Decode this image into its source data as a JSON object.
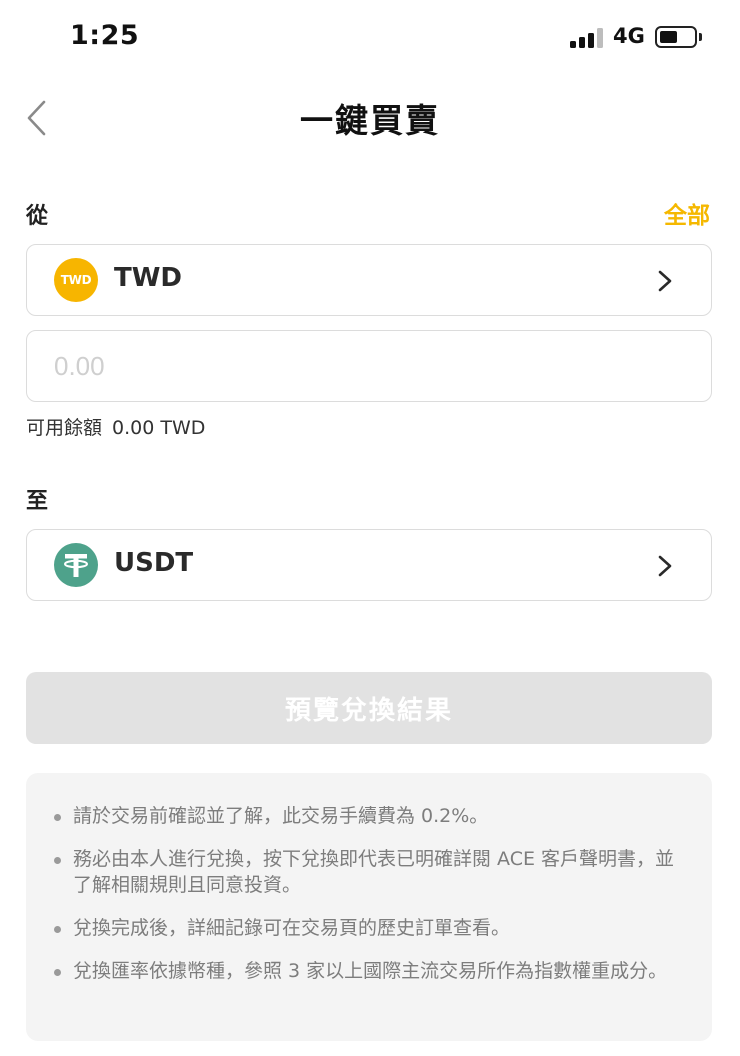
{
  "status_bar": {
    "time": "1:25",
    "network": "4G"
  },
  "header": {
    "title": "一鍵買賣",
    "back_icon": "chevron-left-icon"
  },
  "from": {
    "label": "從",
    "all_label": "全部",
    "currency": {
      "code": "TWD",
      "icon_text": "TWD",
      "icon_color": "#f7b500"
    },
    "amount_placeholder": "0.00",
    "balance_label": "可用餘額",
    "balance_value": "0.00 TWD"
  },
  "to": {
    "label": "至",
    "currency": {
      "code": "USDT",
      "icon": "tether-icon",
      "icon_color": "#4ea28b"
    }
  },
  "preview_button": {
    "label": "預覽兌換結果"
  },
  "notes": [
    "請於交易前確認並了解，此交易手續費為 0.2%。",
    "務必由本人進行兌換，按下兌換即代表已明確詳閱 ACE 客戶聲明書，並了解相關規則且同意投資。",
    "兌換完成後，詳細記錄可在交易頁的歷史訂單查看。",
    "兌換匯率依據幣種，參照 3 家以上國際主流交易所作為指數權重成分。"
  ],
  "colors": {
    "accent": "#f5b800",
    "button_disabled": "#e2e2e2",
    "notes_bg": "#f4f4f4"
  }
}
